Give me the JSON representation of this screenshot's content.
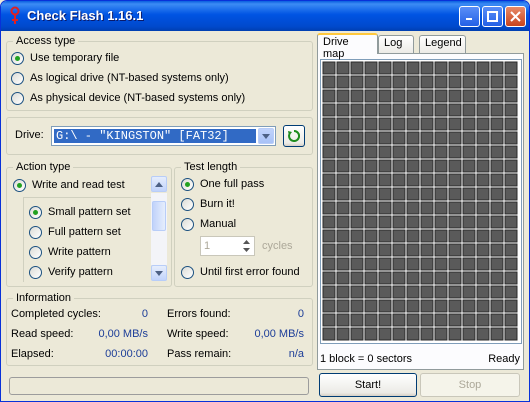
{
  "window": {
    "title": "Check Flash 1.16.1"
  },
  "access_type": {
    "title": "Access type",
    "options": [
      "Use temporary file",
      "As logical drive (NT-based systems only)",
      "As physical device (NT-based systems only)"
    ],
    "selected": 0
  },
  "drive": {
    "label": "Drive:",
    "value": "G:\\ - \"KINGSTON\" [FAT32]"
  },
  "action_type": {
    "title": "Action type",
    "write_read": "Write and read test",
    "patterns": [
      "Small pattern set",
      "Full pattern set",
      "Write pattern",
      "Verify pattern"
    ],
    "selected": 0
  },
  "test_length": {
    "title": "Test length",
    "options": [
      "One full pass",
      "Burn it!",
      "Manual"
    ],
    "cycles_value": "1",
    "cycles_unit": "cycles",
    "until_error": "Until first error found",
    "selected": 0
  },
  "information": {
    "title": "Information",
    "completed_cycles_label": "Completed cycles:",
    "completed_cycles": "0",
    "errors_found_label": "Errors found:",
    "errors_found": "0",
    "read_speed_label": "Read speed:",
    "read_speed": "0,00 MB/s",
    "write_speed_label": "Write speed:",
    "write_speed": "0,00 MB/s",
    "elapsed_label": "Elapsed:",
    "elapsed": "00:00:00",
    "pass_remain_label": "Pass remain:",
    "pass_remain": "n/a"
  },
  "tabs": [
    "Drive map",
    "Log",
    "Legend"
  ],
  "map": {
    "block_info": "1 block = 0 sectors",
    "status": "Ready"
  },
  "buttons": {
    "start": "Start!",
    "stop": "Stop"
  },
  "colors": {
    "title_bar": "#0054e3",
    "value_text": "#1c3d98",
    "selection": "#316ac5"
  },
  "icons": {
    "app": "usb-plug-icon",
    "refresh": "refresh-icon"
  }
}
